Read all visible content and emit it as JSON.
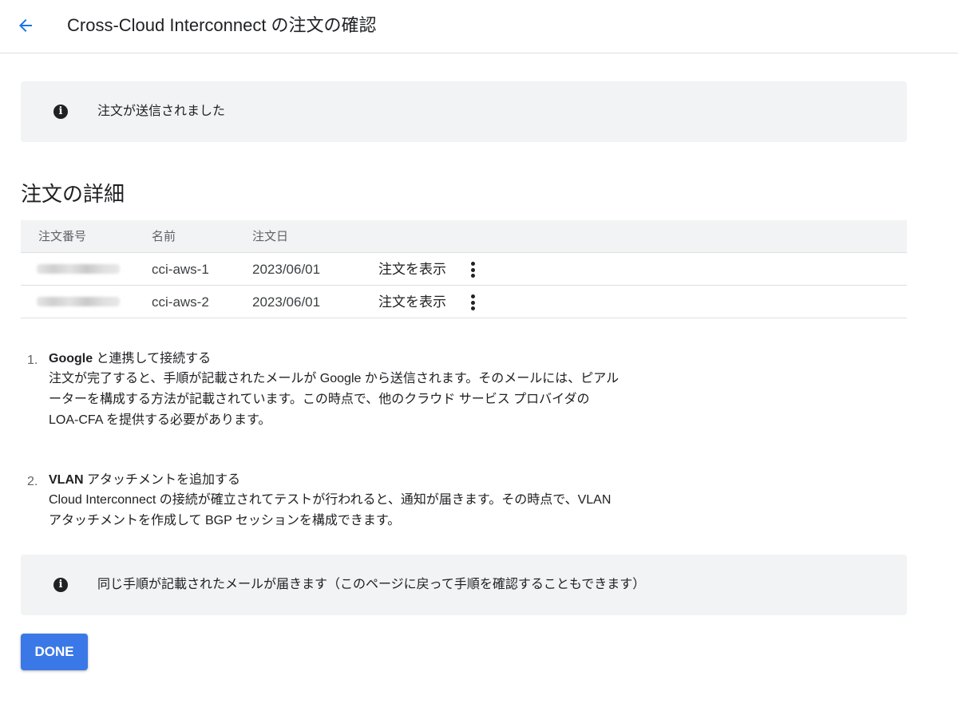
{
  "header": {
    "title": "Cross-Cloud Interconnect の注文の確認",
    "back_icon": "arrow-back-icon"
  },
  "banner_top": {
    "icon": "info-icon",
    "text": "注文が送信されました"
  },
  "details": {
    "title": "注文の詳細",
    "columns": [
      "注文番号",
      "名前",
      "注文日"
    ],
    "rows": [
      {
        "order_number": "",
        "name": "cci-aws-1",
        "date": "2023/06/01",
        "action": "注文を表示"
      },
      {
        "order_number": "",
        "name": "cci-aws-2",
        "date": "2023/06/01",
        "action": "注文を表示"
      }
    ]
  },
  "steps": [
    {
      "num": "1.",
      "title_bold": "Google",
      "title_rest": " と連携して接続する",
      "body": "注文が完了すると、手順が記載されたメールが Google から送信されます。そのメールには、ピアルーターを構成する方法が記載されています。この時点で、他のクラウド サービス プロバイダの LOA-CFA を提供する必要があります。"
    },
    {
      "num": "2.",
      "title_bold": "VLAN",
      "title_rest": " アタッチメントを追加する",
      "body": "Cloud Interconnect の接続が確立されてテストが行われると、通知が届きます。その時点で、VLAN アタッチメントを作成して BGP セッションを構成できます。"
    }
  ],
  "banner_bottom": {
    "icon": "info-icon",
    "text": "同じ手順が記載されたメールが届きます（このページに戻って手順を確認することもできます）"
  },
  "done_label": "DONE",
  "colors": {
    "accent": "#1a73e8",
    "button": "#3b78e7",
    "banner_bg": "#f1f3f4"
  }
}
